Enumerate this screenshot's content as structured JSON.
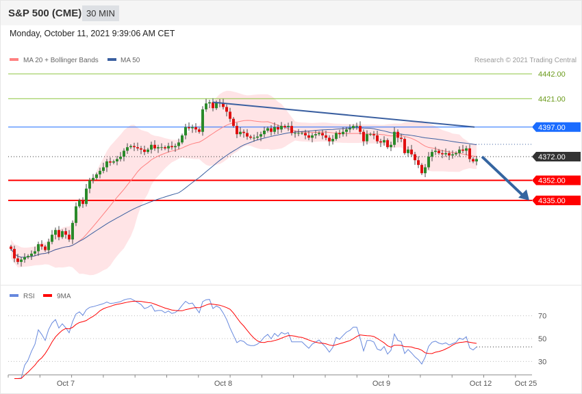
{
  "header": {
    "title": "S&P 500 (CME)",
    "timeframe": "30 MIN",
    "date": "Monday, October 11, 2021 9:39:06 AM CET"
  },
  "legend": {
    "ma20": "MA 20 + Bollinger Bands",
    "ma50": "MA 50",
    "rsi": "RSI",
    "rsi_ma": "9MA",
    "copyright": "Research © 2021 Trading Central"
  },
  "colors": {
    "up": "#2a8a2a",
    "down": "#e01010",
    "ma20": "#ff8080",
    "ma50": "#3a5fa0",
    "band": "#ffe4e6",
    "resistance": "#8cc63f",
    "support": "#ff0000",
    "pivot": "#333333",
    "target": "#1a6cff",
    "rsi": "#6688dd",
    "rsi_ma": "#ff0000"
  },
  "chart_data": {
    "type": "candlestick",
    "price_levels": [
      {
        "value": 4442.0,
        "label": "4442.00",
        "kind": "resistance"
      },
      {
        "value": 4421.0,
        "label": "4421.00",
        "kind": "resistance"
      },
      {
        "value": 4397.0,
        "label": "4397.00",
        "kind": "target"
      },
      {
        "value": 4372.0,
        "label": "4372.00",
        "kind": "pivot"
      },
      {
        "value": 4352.0,
        "label": "4352.00",
        "kind": "support"
      },
      {
        "value": 4335.0,
        "label": "4335.00",
        "kind": "support"
      }
    ],
    "closes": [
      4294,
      4286,
      4283,
      4285,
      4287,
      4288,
      4290,
      4292,
      4298,
      4296,
      4293,
      4300,
      4306,
      4310,
      4304,
      4309,
      4306,
      4302,
      4316,
      4330,
      4335,
      4332,
      4345,
      4352,
      4354,
      4357,
      4360,
      4363,
      4368,
      4367,
      4368,
      4370,
      4372,
      4377,
      4380,
      4381,
      4380,
      4379,
      4378,
      4376,
      4378,
      4382,
      4379,
      4380,
      4380,
      4379,
      4381,
      4380,
      4381,
      4384,
      4390,
      4397,
      4396,
      4397,
      4395,
      4393,
      4412,
      4417,
      4418,
      4413,
      4418,
      4417,
      4414,
      4410,
      4404,
      4398,
      4391,
      4393,
      4392,
      4389,
      4388,
      4388,
      4389,
      4391,
      4394,
      4396,
      4393,
      4397,
      4395,
      4398,
      4397,
      4398,
      4392,
      4392,
      4392,
      4392,
      4390,
      4388,
      4390,
      4391,
      4392,
      4390,
      4388,
      4385,
      4387,
      4392,
      4391,
      4393,
      4395,
      4396,
      4398,
      4398,
      4393,
      4385,
      4391,
      4391,
      4390,
      4385,
      4384,
      4386,
      4380,
      4382,
      4393,
      4388,
      4387,
      4375,
      4378,
      4374,
      4369,
      4365,
      4358,
      4363,
      4372,
      4376,
      4377,
      4375,
      4374,
      4375,
      4373,
      4374,
      4375,
      4378,
      4377,
      4379,
      4370,
      4368,
      4370
    ],
    "x_ticks": [
      "Oct 7",
      "Oct 8",
      "Oct 9",
      "Oct 12",
      "Oct 25"
    ],
    "rsi_ticks": [
      {
        "value": 70,
        "label": "70"
      },
      {
        "value": 50,
        "label": "50"
      },
      {
        "value": 30,
        "label": "30"
      }
    ],
    "trendline": {
      "from_price": 4418,
      "to_price": 4397
    },
    "forecast_arrow": {
      "from_price": 4372,
      "to_price": 4335
    }
  }
}
